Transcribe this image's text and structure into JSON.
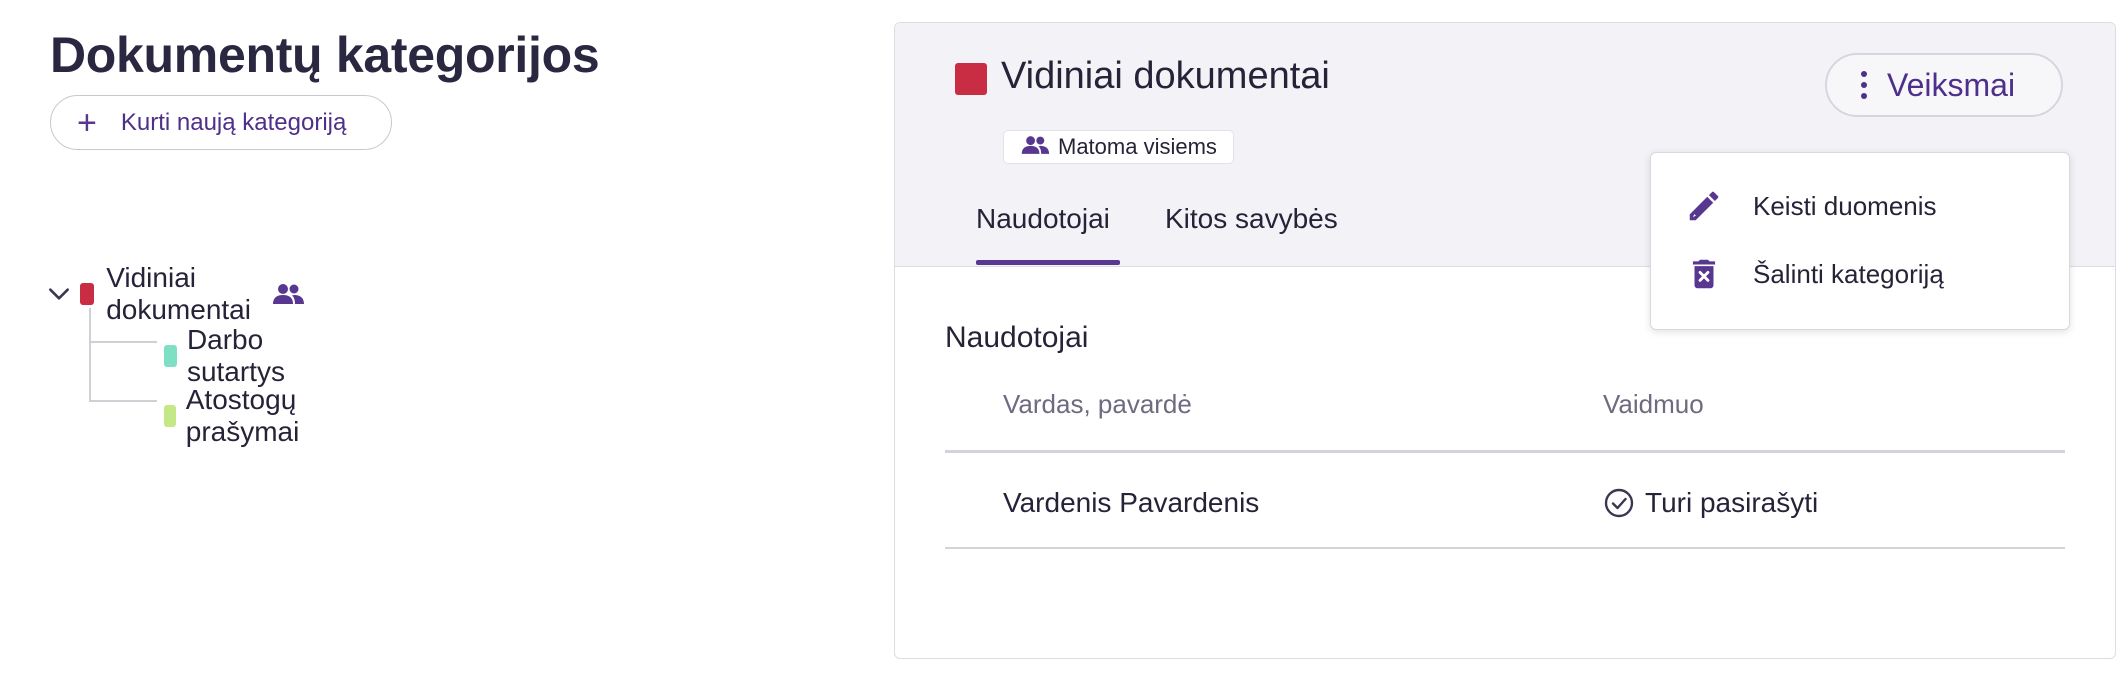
{
  "page": {
    "title": "Dokumentų kategorijos",
    "create_button_label": "Kurti naują kategoriją"
  },
  "tree": {
    "root": {
      "label": "Vidiniai dokumentai",
      "color": "#c92d43"
    },
    "children": [
      {
        "label": "Darbo sutartys",
        "color": "#7ddfc3"
      },
      {
        "label": "Atostogų prašymai",
        "color": "#c3e887"
      }
    ]
  },
  "detail": {
    "title": "Vidiniai dokumentai",
    "color": "#c92d43",
    "visibility_badge": "Matoma visiems",
    "actions_label": "Veiksmai",
    "tabs": [
      {
        "label": "Naudotojai",
        "active": true
      },
      {
        "label": "Kitos savybės",
        "active": false
      }
    ],
    "section_title": "Naudotojai",
    "table": {
      "columns": [
        "Vardas, pavardė",
        "Vaidmuo"
      ],
      "rows": [
        {
          "name": "Vardenis Pavardenis",
          "role": "Turi pasirašyti"
        }
      ]
    }
  },
  "menu": {
    "items": [
      {
        "label": "Keisti duomenis",
        "icon": "pencil-icon"
      },
      {
        "label": "Šalinti kategoriją",
        "icon": "trash-icon"
      }
    ]
  },
  "colors": {
    "accent": "#57378f",
    "title_text": "#2a2740"
  }
}
